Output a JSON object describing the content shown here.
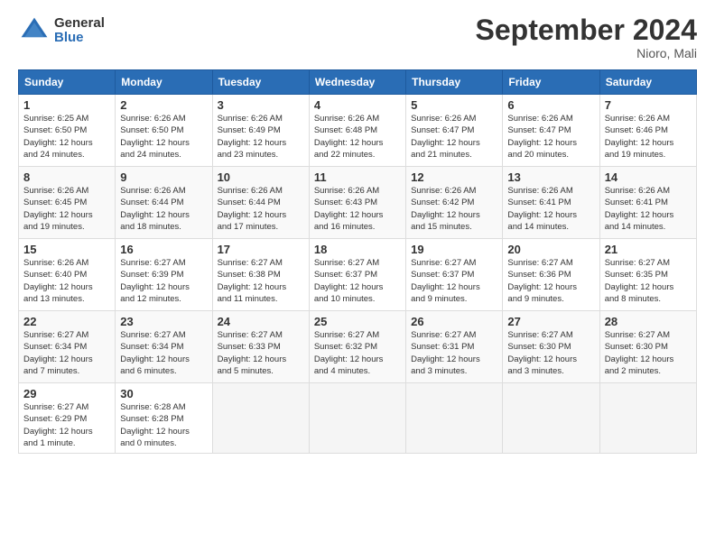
{
  "logo": {
    "general": "General",
    "blue": "Blue"
  },
  "title": "September 2024",
  "location": "Nioro, Mali",
  "days_header": [
    "Sunday",
    "Monday",
    "Tuesday",
    "Wednesday",
    "Thursday",
    "Friday",
    "Saturday"
  ],
  "weeks": [
    [
      {
        "day": "1",
        "sunrise": "6:25 AM",
        "sunset": "6:50 PM",
        "daylight": "12 hours and 24 minutes."
      },
      {
        "day": "2",
        "sunrise": "6:26 AM",
        "sunset": "6:50 PM",
        "daylight": "12 hours and 24 minutes."
      },
      {
        "day": "3",
        "sunrise": "6:26 AM",
        "sunset": "6:49 PM",
        "daylight": "12 hours and 23 minutes."
      },
      {
        "day": "4",
        "sunrise": "6:26 AM",
        "sunset": "6:48 PM",
        "daylight": "12 hours and 22 minutes."
      },
      {
        "day": "5",
        "sunrise": "6:26 AM",
        "sunset": "6:47 PM",
        "daylight": "12 hours and 21 minutes."
      },
      {
        "day": "6",
        "sunrise": "6:26 AM",
        "sunset": "6:47 PM",
        "daylight": "12 hours and 20 minutes."
      },
      {
        "day": "7",
        "sunrise": "6:26 AM",
        "sunset": "6:46 PM",
        "daylight": "12 hours and 19 minutes."
      }
    ],
    [
      {
        "day": "8",
        "sunrise": "6:26 AM",
        "sunset": "6:45 PM",
        "daylight": "12 hours and 19 minutes."
      },
      {
        "day": "9",
        "sunrise": "6:26 AM",
        "sunset": "6:44 PM",
        "daylight": "12 hours and 18 minutes."
      },
      {
        "day": "10",
        "sunrise": "6:26 AM",
        "sunset": "6:44 PM",
        "daylight": "12 hours and 17 minutes."
      },
      {
        "day": "11",
        "sunrise": "6:26 AM",
        "sunset": "6:43 PM",
        "daylight": "12 hours and 16 minutes."
      },
      {
        "day": "12",
        "sunrise": "6:26 AM",
        "sunset": "6:42 PM",
        "daylight": "12 hours and 15 minutes."
      },
      {
        "day": "13",
        "sunrise": "6:26 AM",
        "sunset": "6:41 PM",
        "daylight": "12 hours and 14 minutes."
      },
      {
        "day": "14",
        "sunrise": "6:26 AM",
        "sunset": "6:41 PM",
        "daylight": "12 hours and 14 minutes."
      }
    ],
    [
      {
        "day": "15",
        "sunrise": "6:26 AM",
        "sunset": "6:40 PM",
        "daylight": "12 hours and 13 minutes."
      },
      {
        "day": "16",
        "sunrise": "6:27 AM",
        "sunset": "6:39 PM",
        "daylight": "12 hours and 12 minutes."
      },
      {
        "day": "17",
        "sunrise": "6:27 AM",
        "sunset": "6:38 PM",
        "daylight": "12 hours and 11 minutes."
      },
      {
        "day": "18",
        "sunrise": "6:27 AM",
        "sunset": "6:37 PM",
        "daylight": "12 hours and 10 minutes."
      },
      {
        "day": "19",
        "sunrise": "6:27 AM",
        "sunset": "6:37 PM",
        "daylight": "12 hours and 9 minutes."
      },
      {
        "day": "20",
        "sunrise": "6:27 AM",
        "sunset": "6:36 PM",
        "daylight": "12 hours and 9 minutes."
      },
      {
        "day": "21",
        "sunrise": "6:27 AM",
        "sunset": "6:35 PM",
        "daylight": "12 hours and 8 minutes."
      }
    ],
    [
      {
        "day": "22",
        "sunrise": "6:27 AM",
        "sunset": "6:34 PM",
        "daylight": "12 hours and 7 minutes."
      },
      {
        "day": "23",
        "sunrise": "6:27 AM",
        "sunset": "6:34 PM",
        "daylight": "12 hours and 6 minutes."
      },
      {
        "day": "24",
        "sunrise": "6:27 AM",
        "sunset": "6:33 PM",
        "daylight": "12 hours and 5 minutes."
      },
      {
        "day": "25",
        "sunrise": "6:27 AM",
        "sunset": "6:32 PM",
        "daylight": "12 hours and 4 minutes."
      },
      {
        "day": "26",
        "sunrise": "6:27 AM",
        "sunset": "6:31 PM",
        "daylight": "12 hours and 3 minutes."
      },
      {
        "day": "27",
        "sunrise": "6:27 AM",
        "sunset": "6:30 PM",
        "daylight": "12 hours and 3 minutes."
      },
      {
        "day": "28",
        "sunrise": "6:27 AM",
        "sunset": "6:30 PM",
        "daylight": "12 hours and 2 minutes."
      }
    ],
    [
      {
        "day": "29",
        "sunrise": "6:27 AM",
        "sunset": "6:29 PM",
        "daylight": "12 hours and 1 minute."
      },
      {
        "day": "30",
        "sunrise": "6:28 AM",
        "sunset": "6:28 PM",
        "daylight": "12 hours and 0 minutes."
      },
      null,
      null,
      null,
      null,
      null
    ]
  ]
}
